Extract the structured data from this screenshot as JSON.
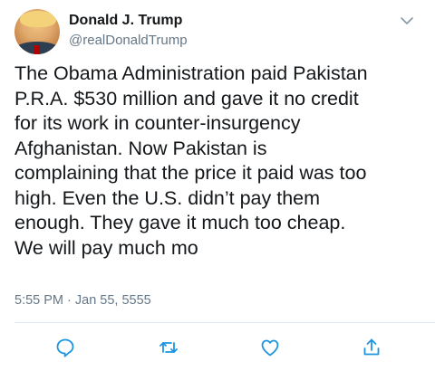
{
  "tweet": {
    "author_name": "Donald J. Trump",
    "author_handle": "@realDonaldTrump",
    "text": "The Obama Administration paid Pakistan\nP.R.A. $530 million and gave it no credit\nfor its work in counter-insurgency\nAfghanistan. Now Pakistan is\ncomplaining that the price it paid was too\nhigh. Even the U.S. didn’t pay them\nenough. They gave it much too cheap.\nWe will pay much mo",
    "timestamp": "5:55 PM · Jan 55, 5555"
  },
  "icons": {
    "menu": "chevron-down-icon",
    "reply": "reply-icon",
    "retweet": "retweet-icon",
    "like": "heart-icon",
    "share": "share-icon"
  },
  "colors": {
    "text": "#14171a",
    "secondary": "#657786",
    "divider": "#e1e8ed"
  }
}
